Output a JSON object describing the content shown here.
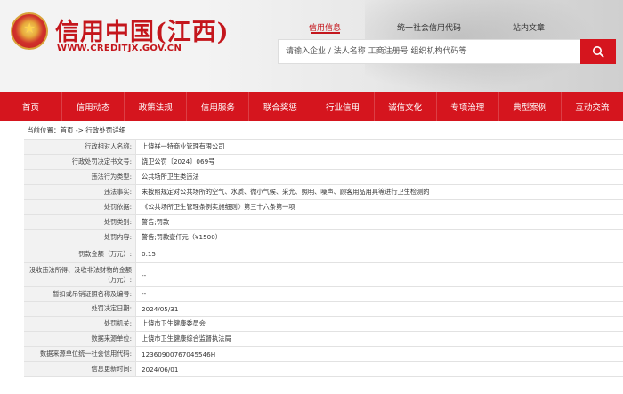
{
  "header": {
    "title": "信用中国(江西)",
    "domain": "WWW.CREDITJX.GOV.CN",
    "emblem_icon": "national-emblem-icon",
    "tabs": [
      "信用信息",
      "统一社会信用代码",
      "站内文章"
    ],
    "search": {
      "placeholder": "请输入企业 / 法人名称 工商注册号 组织机构代码等",
      "icon": "search-icon"
    }
  },
  "nav": [
    "首页",
    "信用动态",
    "政策法规",
    "信用服务",
    "联合奖惩",
    "行业信用",
    "诚信文化",
    "专项治理",
    "典型案例",
    "互动交流"
  ],
  "breadcrumb": "当前位置：首页 -> 行政处罚详细",
  "details": [
    {
      "label": "行政相对人名称:",
      "value": "上饶祥一特商业管理有限公司"
    },
    {
      "label": "行政处罚决定书文号:",
      "value": "饶卫公罚〔2024〕069号"
    },
    {
      "label": "违法行为类型:",
      "value": "公共场所卫生类违法"
    },
    {
      "label": "违法事实:",
      "value": "未按照规定对公共场所的空气、水质、微小气候、采光、照明、噪声、顾客用品用具等进行卫生检测的"
    },
    {
      "label": "处罚依据:",
      "value": "《公共场所卫生管理条例实施细则》第三十六条第一项"
    },
    {
      "label": "处罚类别:",
      "value": "警告;罚款"
    },
    {
      "label": "处罚内容:",
      "value": "警告;罚款壹仟元（¥1500）"
    },
    {
      "label": "罚款金额（万元）:",
      "value": "0.15"
    },
    {
      "label": "没收违法所得、没收非法财物的金额（万元）:",
      "value": "--"
    },
    {
      "label": "暂扣或吊销证照名称及编号:",
      "value": "--"
    },
    {
      "label": "处罚决定日期:",
      "value": "2024/05/31"
    },
    {
      "label": "处罚机关:",
      "value": "上饶市卫生健康委员会"
    },
    {
      "label": "数据来源单位:",
      "value": "上饶市卫生健康综合监督执法局"
    },
    {
      "label": "数据来源单位统一社会信用代码:",
      "value": "12360900767045546H"
    },
    {
      "label": "信息更新时间:",
      "value": "2024/06/01"
    }
  ],
  "colors": {
    "brand_red": "#d5151e",
    "label_bg": "#f2f2f2"
  }
}
